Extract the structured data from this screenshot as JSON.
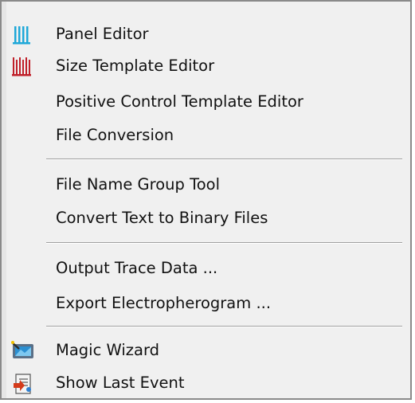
{
  "menu": {
    "groups": [
      {
        "items": [
          {
            "label": "Panel Editor",
            "icon": "panel-editor-icon"
          },
          {
            "label": "Size Template Editor",
            "icon": "size-template-icon"
          },
          {
            "label": "Positive Control Template Editor",
            "icon": ""
          },
          {
            "label": "File Conversion",
            "icon": ""
          }
        ]
      },
      {
        "items": [
          {
            "label": "File Name Group Tool",
            "icon": ""
          },
          {
            "label": "Convert Text to Binary Files",
            "icon": ""
          }
        ]
      },
      {
        "items": [
          {
            "label": "Output Trace Data ...",
            "icon": ""
          },
          {
            "label": "Export Electropherogram ...",
            "icon": ""
          }
        ]
      },
      {
        "items": [
          {
            "label": "Magic Wizard",
            "icon": "magic-wizard-icon"
          },
          {
            "label": "Show Last Event",
            "icon": "show-last-event-icon"
          }
        ]
      }
    ]
  },
  "colors": {
    "menu_background": "#f0f0f0",
    "panel_icon": "#1fa8d8",
    "size_icon": "#c0202a"
  }
}
